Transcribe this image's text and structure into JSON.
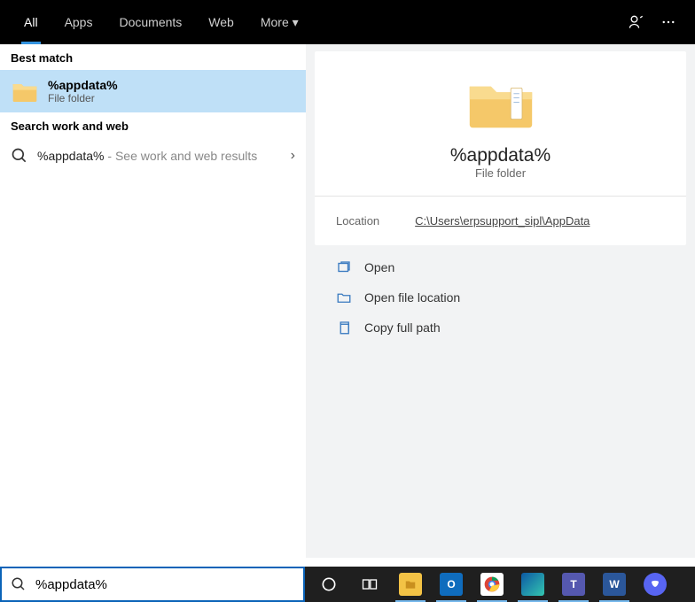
{
  "topbar": {
    "tabs": [
      "All",
      "Apps",
      "Documents",
      "Web",
      "More"
    ],
    "active": 0
  },
  "left": {
    "best_match_header": "Best match",
    "best": {
      "title": "%appdata%",
      "subtitle": "File folder"
    },
    "search_section_header": "Search work and web",
    "work": {
      "query": "%appdata%",
      "suffix": " - See work and web results"
    }
  },
  "preview": {
    "title": "%appdata%",
    "subtitle": "File folder",
    "location_label": "Location",
    "location_value": "C:\\Users\\erpsupport_sipl\\AppData",
    "actions": {
      "open": "Open",
      "open_loc": "Open file location",
      "copy_path": "Copy full path"
    }
  },
  "search": {
    "value": "%appdata%"
  },
  "taskbar": {
    "items": [
      {
        "name": "cortana",
        "color": "transparent",
        "label": "",
        "on": false
      },
      {
        "name": "task-view",
        "color": "transparent",
        "label": "",
        "on": false
      },
      {
        "name": "file-explorer",
        "color": "#f3c245",
        "label": "",
        "on": true
      },
      {
        "name": "outlook",
        "color": "#0f6cbd",
        "label": "O",
        "on": true
      },
      {
        "name": "chrome",
        "color": "#fff",
        "label": "",
        "on": true
      },
      {
        "name": "edge",
        "color": "#1b9e77",
        "label": "",
        "on": true
      },
      {
        "name": "teams",
        "color": "#5558af",
        "label": "T",
        "on": true
      },
      {
        "name": "word",
        "color": "#2b579a",
        "label": "W",
        "on": true
      },
      {
        "name": "discord",
        "color": "#5865f2",
        "label": "",
        "on": false
      }
    ]
  }
}
